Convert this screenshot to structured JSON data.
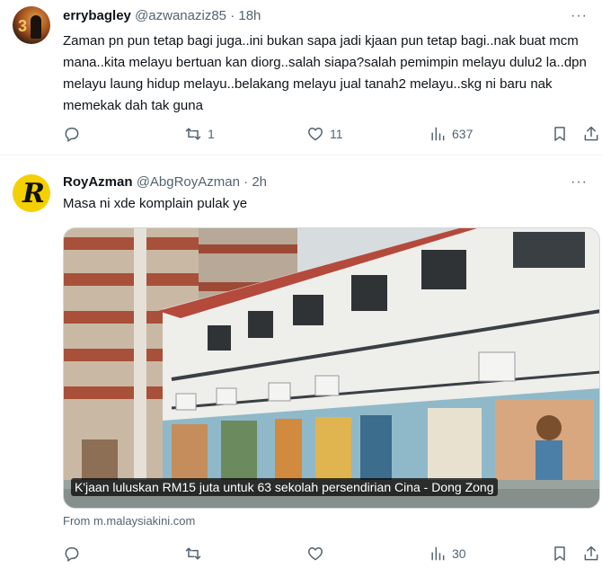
{
  "tweets": [
    {
      "author": {
        "name": "errybagley",
        "handle": "@azwanaziz85",
        "separator": "·",
        "time": "18h",
        "avatar_text": "3"
      },
      "text": "Zaman pn pun tetap bagi juga..ini bukan sapa jadi kjaan pun tetap bagi..nak buat mcm mana..kita melayu bertuan kan diorg..salah siapa?salah pemimpin melayu dulu2 la..dpn melayu laung hidup melayu..belakang melayu jual tanah2 melayu..skg ni baru nak memekak dah tak guna",
      "more": "···",
      "actions": {
        "reply_count": "",
        "retweet_count": "1",
        "like_count": "11",
        "views_count": "637"
      }
    },
    {
      "author": {
        "name": "RoyAzman",
        "handle": "@AbgRoyAzman",
        "separator": "·",
        "time": "2h",
        "avatar_text": "R"
      },
      "text": "Masa ni xde komplain pulak ye",
      "more": "···",
      "media": {
        "caption": "K'jaan luluskan RM15 juta untuk 63 sekolah persendirian Cina - Dong Zong"
      },
      "source": "From m.malaysiakini.com",
      "actions": {
        "reply_count": "",
        "retweet_count": "",
        "like_count": "",
        "views_count": "30"
      }
    }
  ],
  "icons": {
    "reply": "reply-icon",
    "retweet": "retweet-icon",
    "like": "heart-icon",
    "views": "views-icon",
    "bookmark": "bookmark-icon",
    "share": "share-icon"
  },
  "colors": {
    "text": "#0f1419",
    "secondary": "#536471",
    "divider": "#eff3f4",
    "avatar_roy": "#f5d000"
  }
}
